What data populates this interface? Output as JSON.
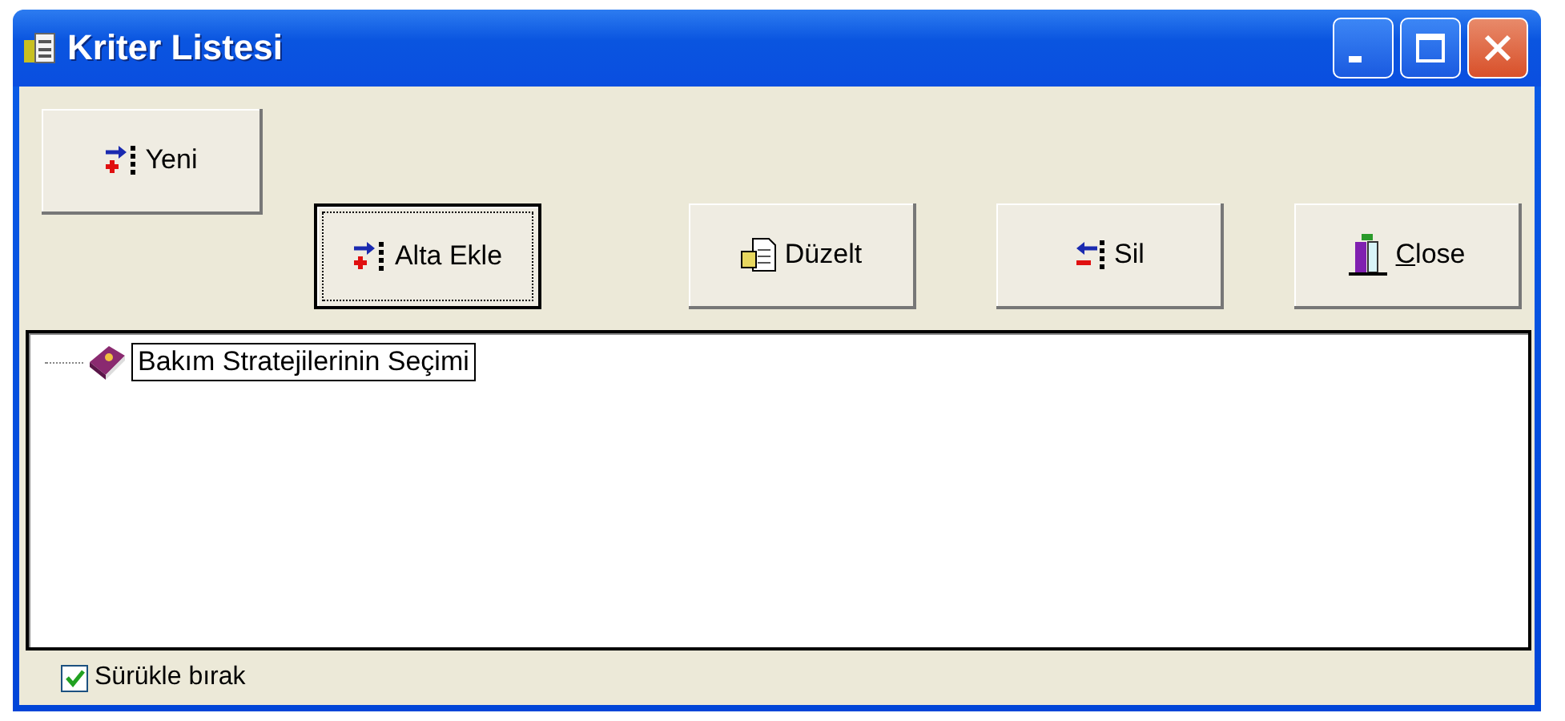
{
  "window": {
    "title": "Kriter Listesi"
  },
  "title_buttons": [
    {
      "kind": "minimize"
    },
    {
      "kind": "maximize"
    },
    {
      "kind": "close"
    }
  ],
  "toolbar": [
    {
      "label": "Yeni",
      "kind": "add",
      "focused": false,
      "mnemonic": false,
      "raised": true
    },
    {
      "label": "Alta Ekle",
      "kind": "add",
      "focused": true,
      "mnemonic": false,
      "raised": false
    },
    {
      "label": "Düzelt",
      "kind": "edit",
      "focused": false,
      "mnemonic": false,
      "raised": false
    },
    {
      "label": "Sil",
      "kind": "remove",
      "focused": false,
      "mnemonic": false,
      "raised": false
    },
    {
      "label": "Close",
      "kind": "exit",
      "focused": false,
      "mnemonic": true,
      "raised": false
    }
  ],
  "tree": {
    "items": [
      {
        "label": "Bakım Stratejilerinin Seçimi",
        "selected": true
      }
    ]
  },
  "options": [
    {
      "label": "Sürükle bırak",
      "checked": true
    }
  ]
}
